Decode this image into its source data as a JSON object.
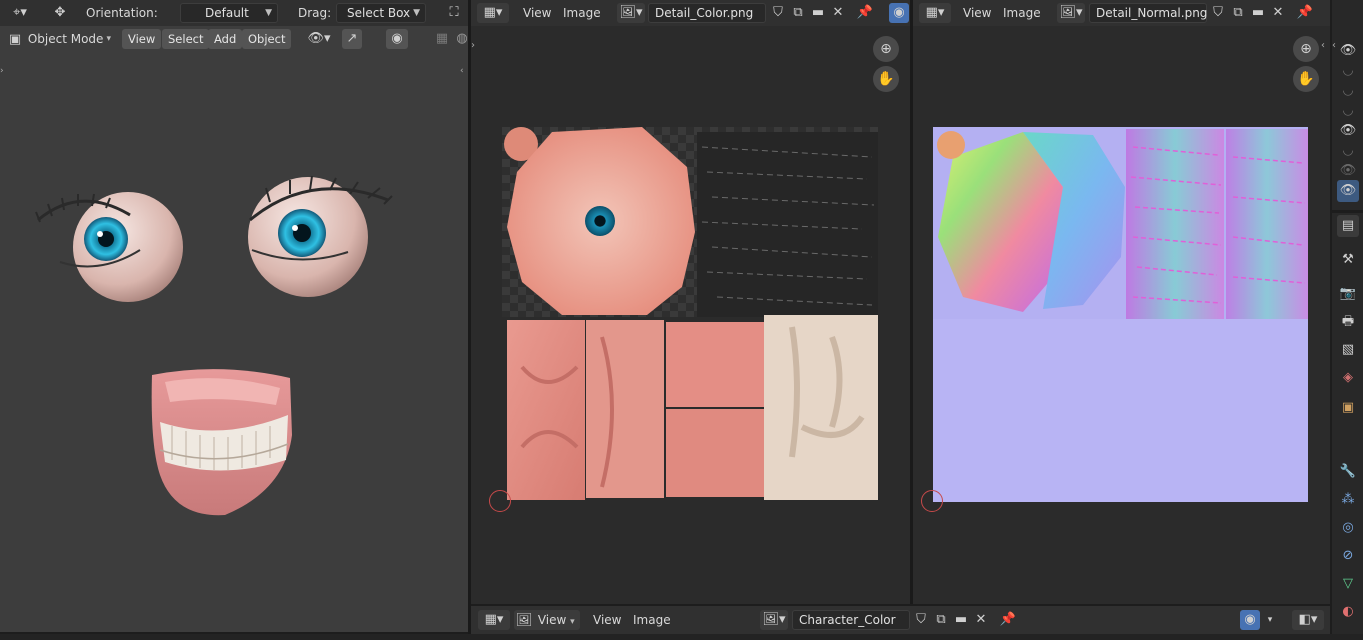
{
  "viewport3d": {
    "orientation_label": "Orientation:",
    "orientation_value": "Default",
    "drag_label": "Drag:",
    "drag_value": "Select Box",
    "mode": "Object Mode",
    "menus": [
      "View",
      "Select",
      "Add",
      "Object"
    ]
  },
  "image_editor_left": {
    "menus": [
      "View",
      "Image"
    ],
    "image_name": "Detail_Color.png"
  },
  "image_editor_right": {
    "menus": [
      "View",
      "Image"
    ],
    "image_name": "Detail_Normal.png"
  },
  "bottom_editor": {
    "view_dropdown": "View",
    "menus": [
      "View",
      "Image"
    ],
    "image_name": "Character_Color"
  },
  "colors": {
    "accent": "#4772b3",
    "background": "#3d3d3d",
    "header": "#303030"
  },
  "icons": [
    "editor-type-icon",
    "transform-icon",
    "snap-icon",
    "image-icon",
    "shield-icon",
    "copy-icon",
    "folder-icon",
    "close-icon",
    "pin-icon",
    "zoom-icon",
    "hand-icon",
    "eye-icon",
    "wrench-icon",
    "render-icon",
    "output-icon",
    "world-icon",
    "object-icon",
    "physics-icon",
    "material-icon"
  ]
}
